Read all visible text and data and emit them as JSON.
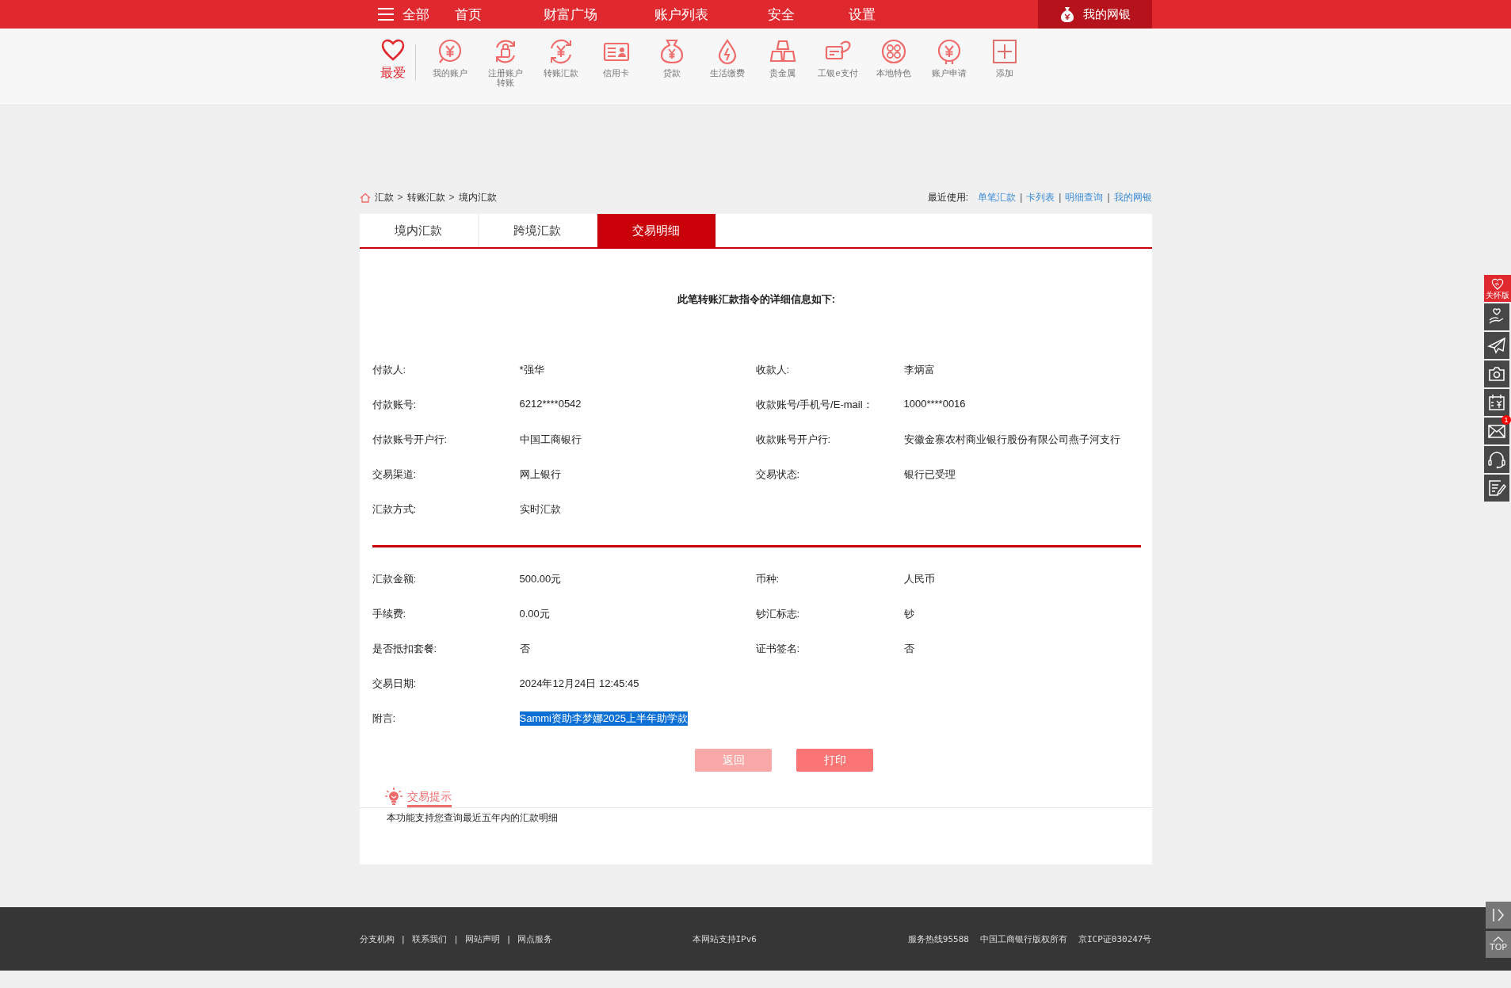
{
  "top_nav": {
    "items": [
      {
        "label": "全部",
        "kind": "menu"
      },
      {
        "label": "首页",
        "kind": "link"
      },
      {
        "label": "财富广场",
        "kind": "link"
      },
      {
        "label": "账户列表",
        "kind": "link"
      },
      {
        "label": "安全",
        "kind": "link"
      },
      {
        "label": "设置",
        "kind": "link"
      }
    ],
    "my_bank": {
      "label": "我的网银"
    }
  },
  "shortcuts": {
    "favorite": {
      "label": "最爱"
    },
    "items": [
      {
        "label": "我的账户"
      },
      {
        "label": "注册账户转账"
      },
      {
        "label": "转账汇款"
      },
      {
        "label": "信用卡"
      },
      {
        "label": "贷款"
      },
      {
        "label": "生活缴费"
      },
      {
        "label": "贵金属"
      },
      {
        "label": "工银e支付"
      },
      {
        "label": "本地特色"
      },
      {
        "label": "账户申请"
      },
      {
        "label": "添加"
      }
    ]
  },
  "breadcrumb": {
    "items": [
      "汇款",
      "转账汇款",
      "境内汇款"
    ],
    "separator": ">"
  },
  "recent": {
    "label": "最近使用:",
    "links": [
      "单笔汇款",
      "卡列表",
      "明细查询",
      "我的网银"
    ],
    "separator": "|"
  },
  "tabs": [
    {
      "label": "境内汇款",
      "selected": false
    },
    {
      "label": "跨境汇款",
      "selected": false
    },
    {
      "label": "交易明细",
      "selected": true
    }
  ],
  "detail": {
    "title": "此笔转账汇款指令的详细信息如下:",
    "sections": [
      {
        "rows": [
          {
            "cells": [
              {
                "label": "付款人:",
                "value": "*强华"
              },
              {
                "label": "收款人:",
                "value": "李炳富"
              }
            ]
          },
          {
            "cells": [
              {
                "label": "付款账号:",
                "value": "6212****0542"
              },
              {
                "label": "收款账号/手机号/E-mail：",
                "value": "1000****0016"
              }
            ]
          },
          {
            "cells": [
              {
                "label": "付款账号开户行:",
                "value": "中国工商银行"
              },
              {
                "label": "收款账号开户行:",
                "value": "安徽金寨农村商业银行股份有限公司燕子河支行"
              }
            ]
          },
          {
            "cells": [
              {
                "label": "交易渠道:",
                "value": "网上银行"
              },
              {
                "label": "交易状态:",
                "value": "银行已受理"
              }
            ]
          },
          {
            "cells": [
              {
                "label": "汇款方式:",
                "value": "实时汇款"
              }
            ]
          }
        ]
      },
      {
        "rows": [
          {
            "cells": [
              {
                "label": "汇款金额:",
                "value": "500.00元"
              },
              {
                "label": "币种:",
                "value": "人民币"
              }
            ]
          },
          {
            "cells": [
              {
                "label": "手续费:",
                "value": "0.00元"
              },
              {
                "label": "钞汇标志:",
                "value": "钞"
              }
            ]
          },
          {
            "cells": [
              {
                "label": "是否抵扣套餐:",
                "value": "否"
              },
              {
                "label": "证书签名:",
                "value": "否"
              }
            ]
          },
          {
            "cells": [
              {
                "label": "交易日期:",
                "value": "2024年12月24日 12:45:45"
              }
            ]
          },
          {
            "cells": [
              {
                "label": "附言:",
                "value": "Sammi资助李梦娜2025上半年助学款",
                "highlighted": true
              }
            ]
          }
        ]
      }
    ],
    "buttons": [
      {
        "label": "返回",
        "kind": "secondary"
      },
      {
        "label": "打印",
        "kind": "primary"
      }
    ]
  },
  "tip": {
    "title": "交易提示",
    "text": "本功能支持您查询最近五年内的汇款明细"
  },
  "side_tools": {
    "care_label": "关怀版",
    "mail_badge": "1",
    "top_label": "TOP"
  },
  "footer": {
    "links": [
      "分支机构",
      "联系我们",
      "网站声明",
      "网点服务"
    ],
    "separator": "|",
    "center": "本网站支持IPv6",
    "right": [
      "服务热线95588",
      "中国工商银行版权所有",
      "京ICP证030247号"
    ]
  }
}
